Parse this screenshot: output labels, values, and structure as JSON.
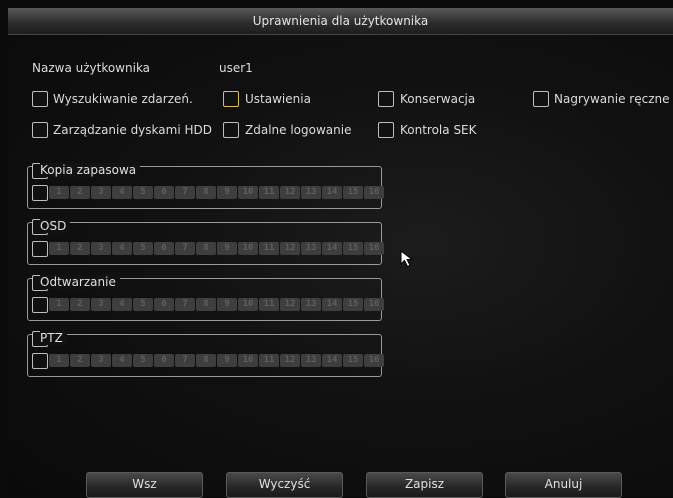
{
  "title": "Uprawnienia dla użytkownika",
  "user": {
    "label": "Nazwa użytkownika",
    "value": "user1"
  },
  "permissions": [
    {
      "label": "Wyszukiwanie zdarzeń."
    },
    {
      "label": "Ustawienia"
    },
    {
      "label": "Konserwacja"
    },
    {
      "label": "Nagrywanie ręczne"
    },
    {
      "label": "Zarządzanie dyskami HDD"
    },
    {
      "label": "Zdalne logowanie"
    },
    {
      "label": "Kontrola SEK"
    }
  ],
  "groups": [
    {
      "title": "Kopia zapasowa"
    },
    {
      "title": "OSD"
    },
    {
      "title": "Odtwarzanie"
    },
    {
      "title": "PTZ"
    }
  ],
  "channels": [
    "1",
    "2",
    "3",
    "4",
    "5",
    "6",
    "7",
    "8",
    "9",
    "10",
    "11",
    "12",
    "13",
    "14",
    "15",
    "16"
  ],
  "buttons": {
    "all": "Wsz",
    "clear": "Wyczyść",
    "save": "Zapisz",
    "cancel": "Anuluj"
  }
}
